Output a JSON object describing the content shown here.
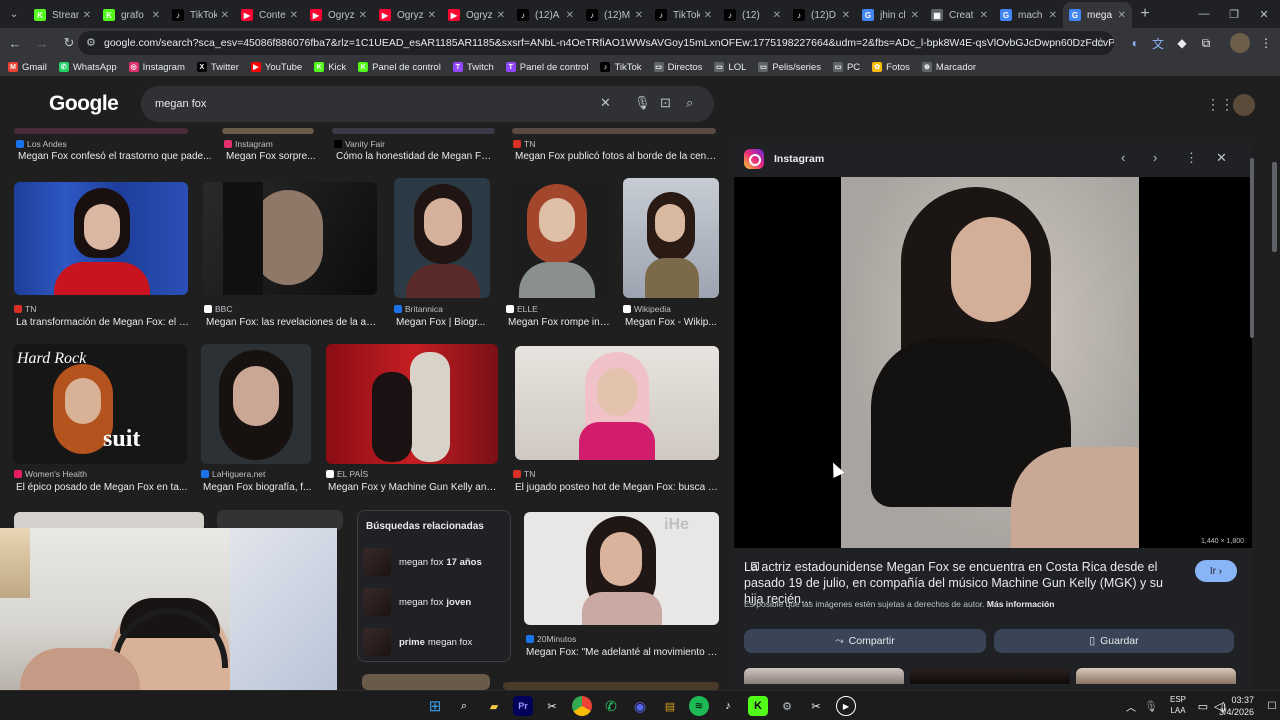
{
  "browser": {
    "tabs": [
      {
        "label": "Stream",
        "fav_color": "#53fc18",
        "fav_text": "K"
      },
      {
        "label": "grafo",
        "fav_color": "#53fc18",
        "fav_text": "K"
      },
      {
        "label": "TikTok",
        "fav_color": "#000000",
        "fav_text": "♪"
      },
      {
        "label": "Conte",
        "fav_color": "#ff0033",
        "fav_text": "▶"
      },
      {
        "label": "Ogryz",
        "fav_color": "#ff0033",
        "fav_text": "▶"
      },
      {
        "label": "Ogryz",
        "fav_color": "#ff0033",
        "fav_text": "▶"
      },
      {
        "label": "Ogryz",
        "fav_color": "#ff0033",
        "fav_text": "▶"
      },
      {
        "label": "(12)A",
        "fav_color": "#000000",
        "fav_text": "♪"
      },
      {
        "label": "(12)M",
        "fav_color": "#000000",
        "fav_text": "♪"
      },
      {
        "label": "TikTok",
        "fav_color": "#000000",
        "fav_text": "♪"
      },
      {
        "label": "(12)",
        "fav_color": "#000000",
        "fav_text": "♪"
      },
      {
        "label": "(12)D",
        "fav_color": "#000000",
        "fav_text": "♪"
      },
      {
        "label": "jhin cl",
        "fav_color": "#4285f4",
        "fav_text": "G"
      },
      {
        "label": "Creat",
        "fav_color": "#5f6368",
        "fav_text": "▦"
      },
      {
        "label": "mach",
        "fav_color": "#4285f4",
        "fav_text": "G"
      },
      {
        "label": "mega",
        "fav_color": "#4285f4",
        "fav_text": "G",
        "active": true
      }
    ],
    "new_tab": "+",
    "url": "google.com/search?sca_esv=45086f886076fba7&rlz=1C1UEAD_esAR1185AR1185&sxsrf=ANbL-n4OeTRfiAO1WWsAVGoy15mLxnOFEw:1775198227664&udm=2&fbs=ADc_l-bpk8W4E-qsVlOvbGJcDwpn60DzFdcvPnuv8WQohHLTbSVldBrj...",
    "bookmarks": [
      {
        "label": "Gmail",
        "color": "#ea4335",
        "glyph": "M"
      },
      {
        "label": "WhatsApp",
        "color": "#25d366",
        "glyph": "✆"
      },
      {
        "label": "Instagram",
        "color": "#e1306c",
        "glyph": "◎"
      },
      {
        "label": "Twitter",
        "color": "#000000",
        "glyph": "X"
      },
      {
        "label": "YouTube",
        "color": "#ff0000",
        "glyph": "▶"
      },
      {
        "label": "Kick",
        "color": "#53fc18",
        "glyph": "K"
      },
      {
        "label": "Panel de control",
        "color": "#53fc18",
        "glyph": "K"
      },
      {
        "label": "Twitch",
        "color": "#9146ff",
        "glyph": "T"
      },
      {
        "label": "Panel de control",
        "color": "#9146ff",
        "glyph": "T"
      },
      {
        "label": "TikTok",
        "color": "#000000",
        "glyph": "♪"
      },
      {
        "label": "Directos",
        "color": "#5f6368",
        "glyph": "▭"
      },
      {
        "label": "LOL",
        "color": "#5f6368",
        "glyph": "▭"
      },
      {
        "label": "Pelis/series",
        "color": "#5f6368",
        "glyph": "▭"
      },
      {
        "label": "PC",
        "color": "#5f6368",
        "glyph": "▭"
      },
      {
        "label": "Fotos",
        "color": "#fbbc04",
        "glyph": "✿"
      },
      {
        "label": "Marcador",
        "color": "#5f6368",
        "glyph": "⊕"
      }
    ]
  },
  "search": {
    "logo": "Google",
    "query": "megan fox"
  },
  "results_row0": [
    {
      "source": "Los Andes",
      "title": "Megan Fox confesó el trastorno que pade...",
      "src_color": "#1a73e8"
    },
    {
      "source": "Instagram",
      "title": "Megan Fox sorpre...",
      "src_color": "#e1306c"
    },
    {
      "source": "Vanity Fair",
      "title": "Cómo la honestidad de Megan Fox...",
      "src_color": "#000000"
    },
    {
      "source": "TN",
      "title": "Megan Fox publicó fotos al borde de la cens...",
      "src_color": "#d93025"
    }
  ],
  "results_row1": [
    {
      "source": "TN",
      "title": "La transformación de Megan Fox: el a...",
      "src_color": "#d93025"
    },
    {
      "source": "BBC",
      "title": "Megan Fox: las revelaciones de la act...",
      "src_color": "#ffffff"
    },
    {
      "source": "Britannica",
      "title": "Megan Fox | Biogr...",
      "src_color": "#1a73e8"
    },
    {
      "source": "ELLE",
      "title": "Megan Fox rompe int...",
      "src_color": "#ffffff"
    },
    {
      "source": "Wikipedia",
      "title": "Megan Fox - Wikip...",
      "src_color": "#ffffff"
    }
  ],
  "results_row2": [
    {
      "source": "Women's Health",
      "title": "El épico posado de Megan Fox en ta...",
      "src_color": "#e91e63"
    },
    {
      "source": "LaHiguera.net",
      "title": "Megan Fox biografía, f...",
      "src_color": "#1a73e8"
    },
    {
      "source": "EL PAÍS",
      "title": "Megan Fox y Machine Gun Kelly anu...",
      "src_color": "#ffffff"
    },
    {
      "source": "TN",
      "title": "El jugado posteo hot de Megan Fox: busca n...",
      "src_color": "#d93025"
    }
  ],
  "results_row3": [
    {
      "source": "20Minutos",
      "title": "Megan Fox: \"Me adelanté al movimiento #...",
      "src_color": "#1a73e8"
    }
  ],
  "related": {
    "heading": "Búsquedas relacionadas",
    "items": [
      {
        "prefix": "megan fox",
        "bold": "17 años"
      },
      {
        "prefix": "megan fox",
        "bold": "joven"
      },
      {
        "prefix": "",
        "bold": "prime",
        "suffix": "megan fox"
      }
    ]
  },
  "preview": {
    "source": "Instagram",
    "dims": "1,440 × 1,800",
    "description": "La actriz estadounidense Megan Fox se encuentra en Costa Rica desde el pasado 19 de julio, en compañía del músico Machine Gun Kelly (MGK) y su hija recién...",
    "go_label": "Ir",
    "rights_text": "Es posible que las imágenes estén sujetas a derechos de autor.",
    "more_info": "Más información",
    "share_label": "Compartir",
    "save_label": "Guardar"
  },
  "taskbar": {
    "lang_top": "ESP",
    "lang_bottom": "LAA",
    "time": "03:37",
    "date": "3/4/2026"
  }
}
